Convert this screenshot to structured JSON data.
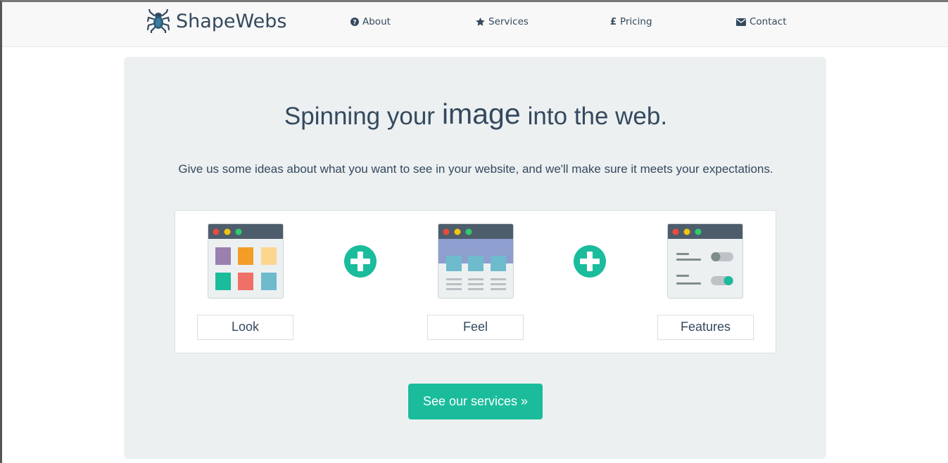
{
  "navbar": {
    "brand_name": "ShapeWebs",
    "brand_icon": "spider-icon",
    "items": [
      {
        "label": "About",
        "icon": "question-circle-icon"
      },
      {
        "label": "Services",
        "icon": "star-icon"
      },
      {
        "label": "Pricing",
        "icon": "pound-sign-icon"
      },
      {
        "label": "Contact",
        "icon": "envelope-icon"
      }
    ]
  },
  "hero": {
    "headline_before": "Spinning your",
    "headline_accent": "image",
    "headline_after": "into the web.",
    "subtitle": "Give us some ideas about what you want to see in your website, and we'll make sure it meets your expectations.",
    "cards": [
      {
        "label": "Look",
        "icon": "look-window-icon"
      },
      {
        "label": "Feel",
        "icon": "feel-window-icon"
      },
      {
        "label": "Features",
        "icon": "features-window-icon"
      }
    ],
    "cta_label": "See our services »"
  },
  "colors": {
    "accent": "#1abc9c",
    "text": "#34495e",
    "jumbotron_bg": "#ecf0f1",
    "navbar_bg": "#f8f8f8"
  }
}
